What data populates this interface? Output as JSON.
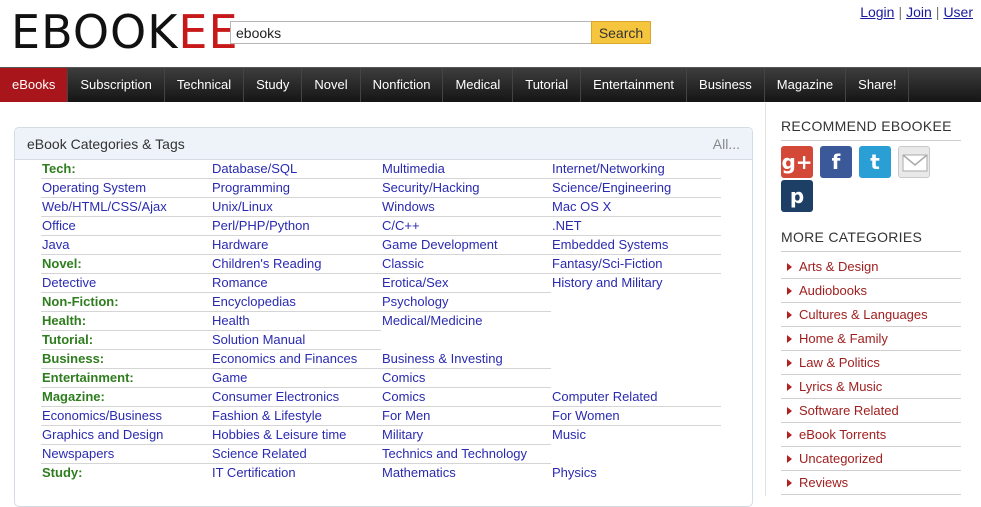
{
  "header": {
    "logo_prefix": "EBOOK",
    "logo_suffix": "EE",
    "search": {
      "value": "ebooks",
      "button_label": "Search"
    },
    "auth": {
      "login": "Login",
      "join": "Join",
      "user": "User",
      "separator": "|"
    }
  },
  "nav": {
    "items": [
      {
        "label": "eBooks"
      },
      {
        "label": "Subscription"
      },
      {
        "label": "Technical"
      },
      {
        "label": "Study"
      },
      {
        "label": "Novel"
      },
      {
        "label": "Nonfiction"
      },
      {
        "label": "Medical"
      },
      {
        "label": "Tutorial"
      },
      {
        "label": "Entertainment"
      },
      {
        "label": "Business"
      },
      {
        "label": "Magazine"
      },
      {
        "label": "Share!"
      }
    ]
  },
  "categories": {
    "title": "eBook Categories & Tags",
    "all_label": "All...",
    "rows": [
      [
        "Tech:",
        "Database/SQL",
        "Multimedia",
        "Internet/Networking"
      ],
      [
        "Operating System",
        "Programming",
        "Security/Hacking",
        "Science/Engineering"
      ],
      [
        "Web/HTML/CSS/Ajax",
        "Unix/Linux",
        "Windows",
        "Mac OS X"
      ],
      [
        "Office",
        "Perl/PHP/Python",
        "C/C++",
        ".NET"
      ],
      [
        "Java",
        "Hardware",
        "Game Development",
        "Embedded Systems"
      ],
      [
        "Novel:",
        "Children's Reading",
        "Classic",
        "Fantasy/Sci-Fiction"
      ],
      [
        "Detective",
        "Romance",
        "Erotica/Sex",
        "History and Military"
      ],
      [
        "Non-Fiction:",
        "Encyclopedias",
        "Psychology",
        ""
      ],
      [
        "Health:",
        "Health",
        "Medical/Medicine",
        ""
      ],
      [
        "Tutorial:",
        "Solution Manual",
        "",
        ""
      ],
      [
        "Business:",
        "Economics and Finances",
        "Business & Investing",
        ""
      ],
      [
        "Entertainment:",
        "Game",
        "Comics",
        ""
      ],
      [
        "Magazine:",
        "Consumer Electronics",
        "Comics",
        "Computer Related"
      ],
      [
        "Economics/Business",
        "Fashion & Lifestyle",
        "For Men",
        "For Women"
      ],
      [
        "Graphics and Design",
        "Hobbies & Leisure time",
        "Military",
        "Music"
      ],
      [
        "Newspapers",
        "Science Related",
        "Technics and Technology",
        ""
      ],
      [
        "Study:",
        "IT Certification",
        "Mathematics",
        "Physics"
      ]
    ],
    "section_headers": [
      "Tech:",
      "Novel:",
      "Non-Fiction:",
      "Health:",
      "Tutorial:",
      "Business:",
      "Entertainment:",
      "Magazine:",
      "Study:"
    ]
  },
  "sidebar": {
    "recommend_title": "RECOMMEND EBOOKEE",
    "social": [
      {
        "name": "google-plus-icon",
        "glyph": "g+",
        "color": "#d34836"
      },
      {
        "name": "facebook-icon",
        "glyph": "f",
        "color": "#3b5998"
      },
      {
        "name": "twitter-icon",
        "glyph": "t",
        "color": "#2a9fd6"
      },
      {
        "name": "email-icon",
        "glyph": "",
        "color": "#e9e9e9"
      },
      {
        "name": "pinboard-icon",
        "glyph": "p",
        "color": "#1d3f66"
      }
    ],
    "more_title": "MORE CATEGORIES",
    "more_items": [
      "Arts & Design",
      "Audiobooks",
      "Cultures & Languages",
      "Home & Family",
      "Law & Politics",
      "Lyrics & Music",
      "Software Related",
      "eBook Torrents",
      "Uncategorized",
      "Reviews"
    ]
  },
  "colors": {
    "accent": "#a8151a",
    "link": "#2a2ab0",
    "section_header": "#2e7d1e",
    "search_button": "#f6c53e"
  }
}
